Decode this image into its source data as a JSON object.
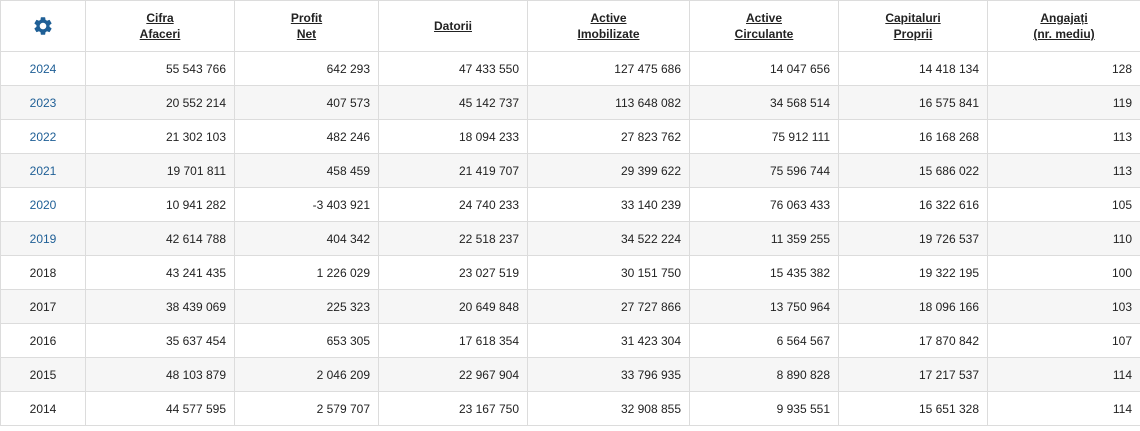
{
  "colors": {
    "gear": "#1f5f96",
    "link": "#1f5f96"
  },
  "header": {
    "settings_icon": "gear-icon",
    "columns": [
      {
        "key": "cifra",
        "lines": [
          "Cifra",
          "Afaceri"
        ]
      },
      {
        "key": "profit",
        "lines": [
          "Profit",
          "Net"
        ]
      },
      {
        "key": "datorii",
        "lines": [
          "Datorii"
        ]
      },
      {
        "key": "active_imob",
        "lines": [
          "Active",
          "Imobilizate"
        ]
      },
      {
        "key": "active_circ",
        "lines": [
          "Active",
          "Circulante"
        ]
      },
      {
        "key": "capitaluri",
        "lines": [
          "Capitaluri",
          "Proprii"
        ]
      },
      {
        "key": "angajati",
        "lines": [
          "Angajați",
          "(nr. mediu)"
        ]
      }
    ]
  },
  "rows": [
    {
      "year": "2024",
      "link": true,
      "values": [
        "55 543 766",
        "642 293",
        "47 433 550",
        "127 475 686",
        "14 047 656",
        "14 418 134",
        "128"
      ]
    },
    {
      "year": "2023",
      "link": true,
      "values": [
        "20 552 214",
        "407 573",
        "45 142 737",
        "113 648 082",
        "34 568 514",
        "16 575 841",
        "119"
      ]
    },
    {
      "year": "2022",
      "link": true,
      "values": [
        "21 302 103",
        "482 246",
        "18 094 233",
        "27 823 762",
        "75 912 111",
        "16 168 268",
        "113"
      ]
    },
    {
      "year": "2021",
      "link": true,
      "values": [
        "19 701 811",
        "458 459",
        "21 419 707",
        "29 399 622",
        "75 596 744",
        "15 686 022",
        "113"
      ]
    },
    {
      "year": "2020",
      "link": true,
      "values": [
        "10 941 282",
        "-3 403 921",
        "24 740 233",
        "33 140 239",
        "76 063 433",
        "16 322 616",
        "105"
      ]
    },
    {
      "year": "2019",
      "link": true,
      "values": [
        "42 614 788",
        "404 342",
        "22 518 237",
        "34 522 224",
        "11 359 255",
        "19 726 537",
        "110"
      ]
    },
    {
      "year": "2018",
      "link": false,
      "values": [
        "43 241 435",
        "1 226 029",
        "23 027 519",
        "30 151 750",
        "15 435 382",
        "19 322 195",
        "100"
      ]
    },
    {
      "year": "2017",
      "link": false,
      "values": [
        "38 439 069",
        "225 323",
        "20 649 848",
        "27 727 866",
        "13 750 964",
        "18 096 166",
        "103"
      ]
    },
    {
      "year": "2016",
      "link": false,
      "values": [
        "35 637 454",
        "653 305",
        "17 618 354",
        "31 423 304",
        "6 564 567",
        "17 870 842",
        "107"
      ]
    },
    {
      "year": "2015",
      "link": false,
      "values": [
        "48 103 879",
        "2 046 209",
        "22 967 904",
        "33 796 935",
        "8 890 828",
        "17 217 537",
        "114"
      ]
    },
    {
      "year": "2014",
      "link": false,
      "values": [
        "44 577 595",
        "2 579 707",
        "23 167 750",
        "32 908 855",
        "9 935 551",
        "15 651 328",
        "114"
      ]
    }
  ]
}
